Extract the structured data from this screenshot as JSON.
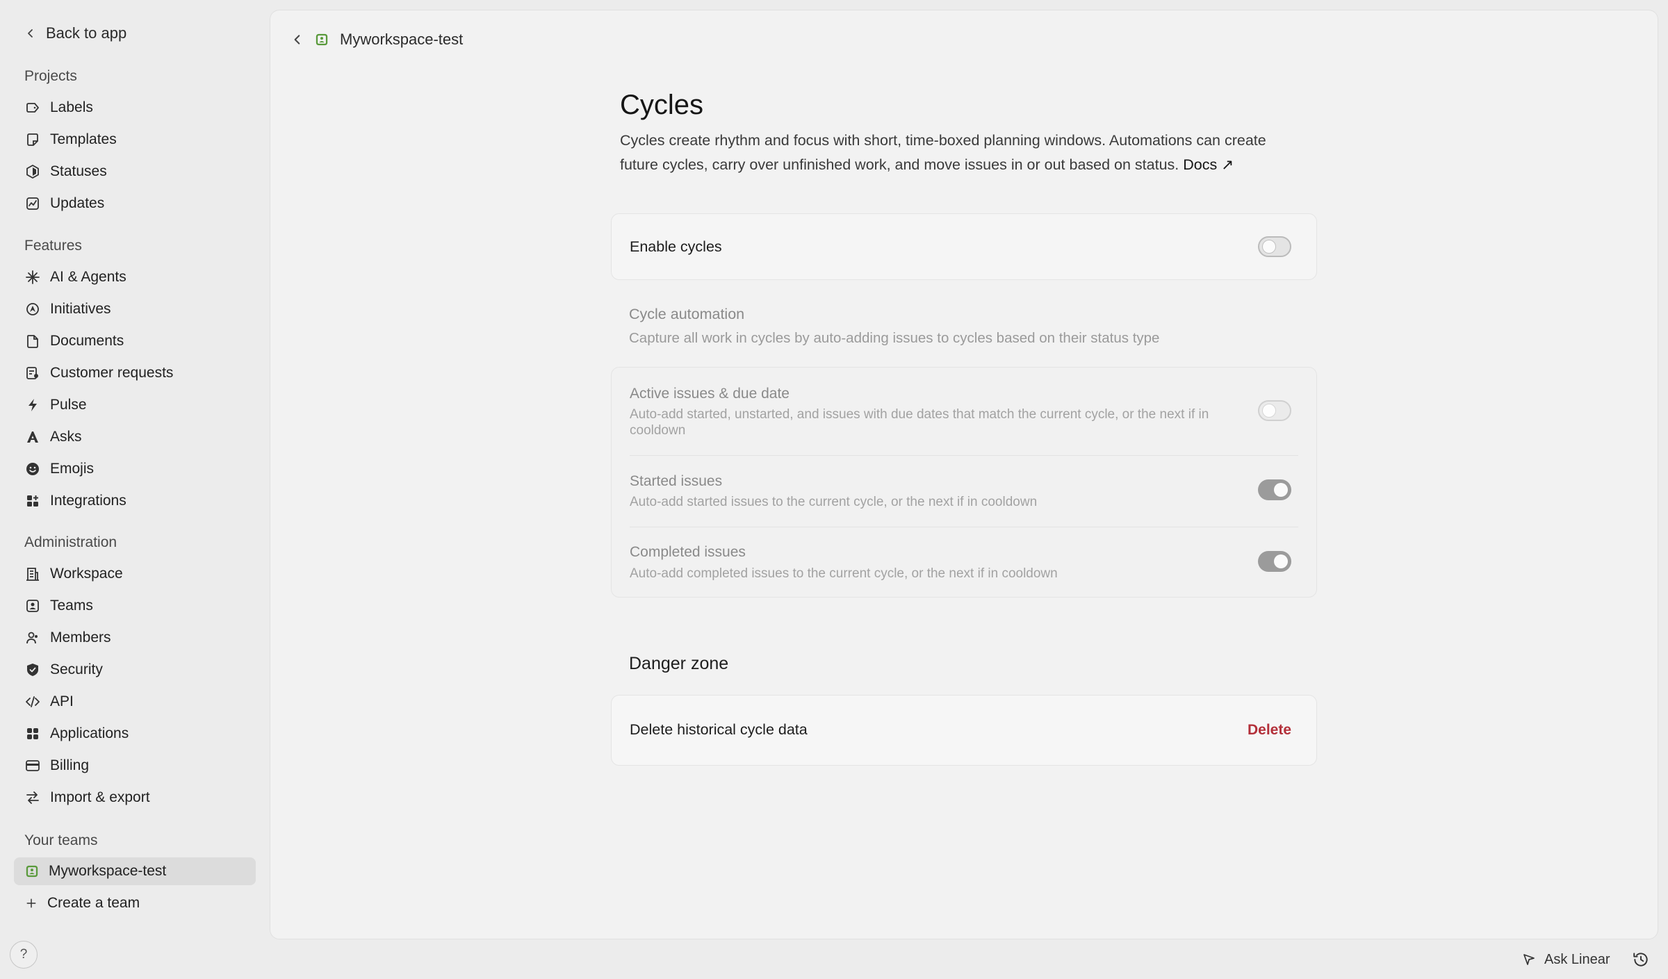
{
  "sidebar": {
    "back_label": "Back to app",
    "sections": {
      "projects": "Projects",
      "features": "Features",
      "administration": "Administration",
      "your_teams": "Your teams"
    },
    "projects": [
      "Labels",
      "Templates",
      "Statuses",
      "Updates"
    ],
    "features": [
      "AI & Agents",
      "Initiatives",
      "Documents",
      "Customer requests",
      "Pulse",
      "Asks",
      "Emojis",
      "Integrations"
    ],
    "administration": [
      "Workspace",
      "Teams",
      "Members",
      "Security",
      "API",
      "Applications",
      "Billing",
      "Import & export"
    ],
    "teams": [
      "Myworkspace-test"
    ],
    "create_team": "Create a team",
    "help": "?"
  },
  "breadcrumb": {
    "team": "Myworkspace-test"
  },
  "page": {
    "title": "Cycles",
    "description": "Cycles create rhythm and focus with short, time-boxed planning windows. Automations can create future cycles, carry over unfinished work, and move issues in or out based on status.",
    "docs_label": "Docs ↗"
  },
  "enable_cycles": {
    "label": "Enable cycles",
    "enabled": false
  },
  "automation": {
    "heading": "Cycle automation",
    "description": "Capture all work in cycles by auto-adding issues to cycles based on their status type",
    "rows": [
      {
        "title": "Active issues & due date",
        "description": "Auto-add started, unstarted, and issues with due dates that match the current cycle, or the next if in cooldown",
        "enabled": false
      },
      {
        "title": "Started issues",
        "description": "Auto-add started issues to the current cycle, or the next if in cooldown",
        "enabled": true
      },
      {
        "title": "Completed issues",
        "description": "Auto-add completed issues to the current cycle, or the next if in cooldown",
        "enabled": true
      }
    ]
  },
  "danger_zone": {
    "title": "Danger zone",
    "label": "Delete historical cycle data",
    "action": "Delete"
  },
  "footer": {
    "ask_linear": "Ask Linear"
  },
  "colors": {
    "danger": "#b3303a",
    "team_icon": "#5a9a3c"
  }
}
